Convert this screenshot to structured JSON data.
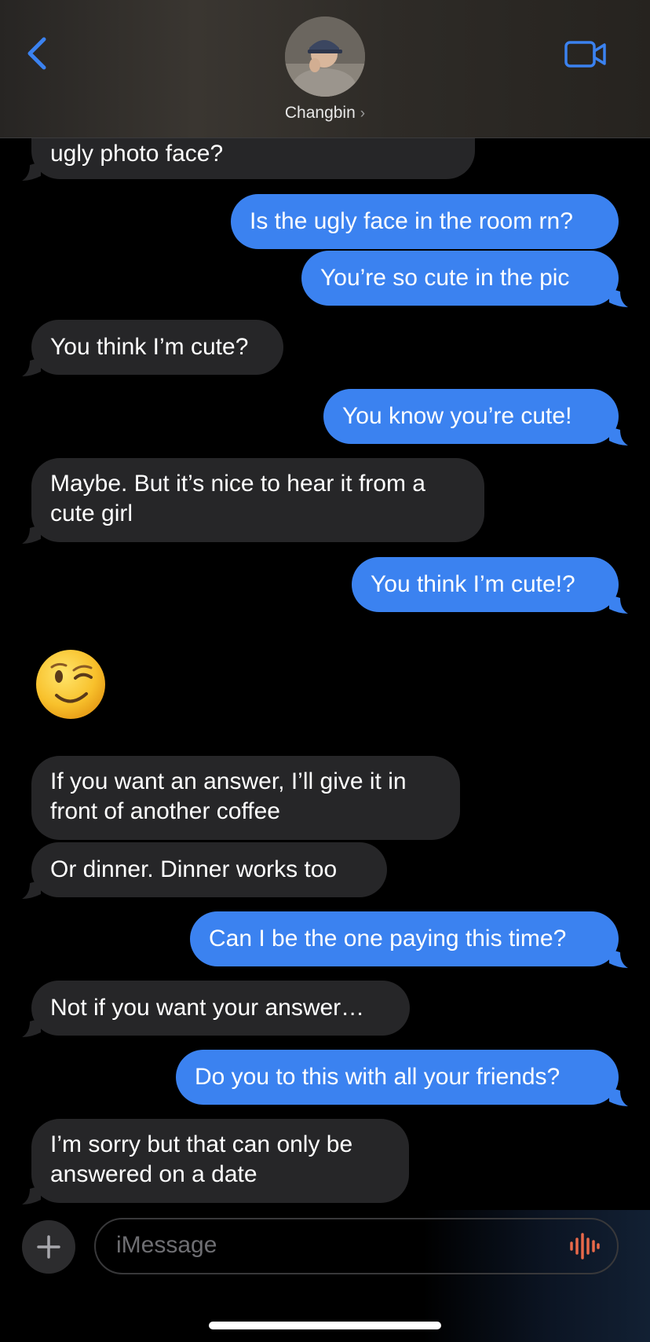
{
  "header": {
    "contact_name": "Changbin",
    "chevron": "›"
  },
  "messages": [
    {
      "dir": "in",
      "text": "ugly photo face?"
    },
    {
      "dir": "out",
      "text": "Is the ugly face in the room rn?"
    },
    {
      "dir": "out",
      "text": "You’re so cute in the pic"
    },
    {
      "dir": "in",
      "text": "You think I’m cute?"
    },
    {
      "dir": "out",
      "text": "You know you’re cute!"
    },
    {
      "dir": "in",
      "text": "Maybe. But it’s nice to hear it from a cute girl"
    },
    {
      "dir": "out",
      "text": "You think I’m cute!?"
    },
    {
      "dir": "in",
      "text": "😉"
    },
    {
      "dir": "in",
      "text": "If you want an answer, I’ll give it in front of another coffee"
    },
    {
      "dir": "in",
      "text": "Or dinner. Dinner works too"
    },
    {
      "dir": "out",
      "text": "Can I be the one paying this time?"
    },
    {
      "dir": "in",
      "text": "Not if you want your answer…"
    },
    {
      "dir": "out",
      "text": "Do you to this with all your friends?"
    },
    {
      "dir": "in",
      "text": "I’m sorry but that can only be answered on a date"
    }
  ],
  "composer": {
    "placeholder": "iMessage"
  },
  "icons": {
    "back": "chevron-left-icon",
    "video": "video-camera-icon",
    "plus": "plus-icon",
    "audio": "waveform-icon",
    "emoji": "winking-face-icon"
  },
  "colors": {
    "outgoing_bubble": "#3b82f0",
    "incoming_bubble": "#262628",
    "accent": "#3b82f0",
    "waveform": "#e8694a"
  }
}
